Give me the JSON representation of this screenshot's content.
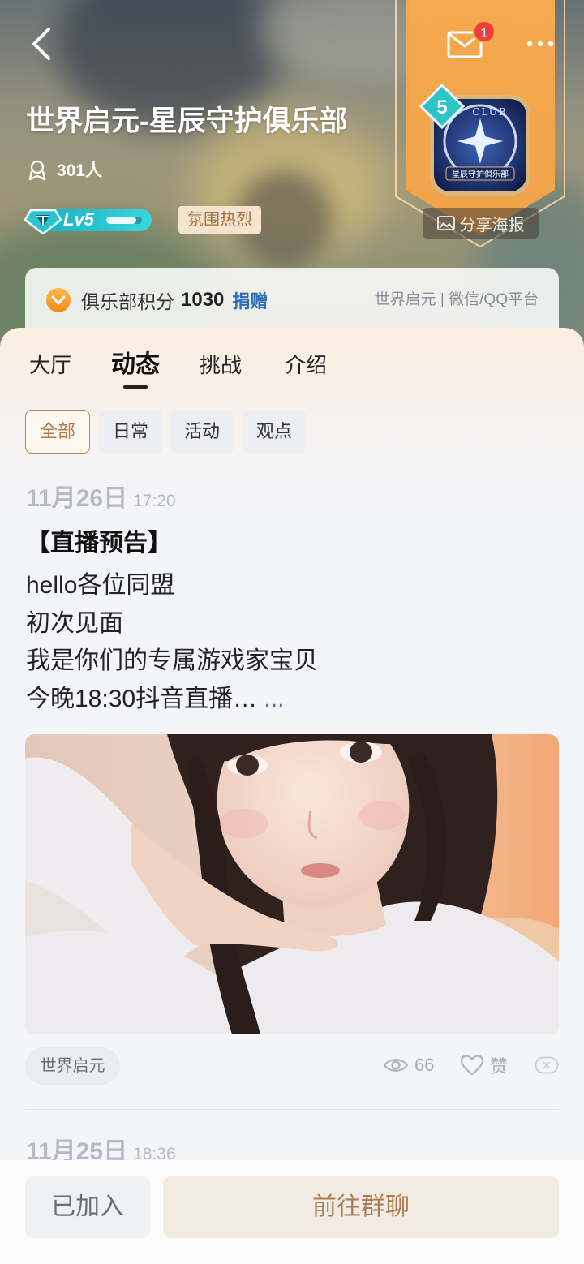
{
  "header": {
    "title": "世界启元-星辰守护俱乐部",
    "members": "301人",
    "level": "Lv5",
    "level_progress": 0.85,
    "atmosphere_tag": "氛围热烈",
    "mail_badge": "1",
    "share_poster": "分享海报",
    "club_level": "5",
    "emblem_top_text": "CLUB",
    "emblem_name": "星辰守护俱乐部"
  },
  "points_card": {
    "label": "俱乐部积分",
    "value": "1030",
    "donate": "捐赠",
    "platform": "世界启元 | 微信/QQ平台"
  },
  "tabs": [
    {
      "label": "大厅",
      "active": false
    },
    {
      "label": "动态",
      "active": true
    },
    {
      "label": "挑战",
      "active": false
    },
    {
      "label": "介绍",
      "active": false
    }
  ],
  "filters": [
    {
      "label": "全部",
      "selected": true
    },
    {
      "label": "日常",
      "selected": false
    },
    {
      "label": "活动",
      "selected": false
    },
    {
      "label": "观点",
      "selected": false
    }
  ],
  "posts": [
    {
      "date": "11月26日",
      "time": "17:20",
      "title": "【直播预告】",
      "lines": [
        "hello各位同盟",
        "初次见面",
        "我是你们的专属游戏家宝贝",
        "今晚18:30抖音直播…"
      ],
      "more": "...",
      "tag": "世界启元",
      "views": "66",
      "like_label": "赞"
    },
    {
      "date": "11月25日",
      "time": "18:36"
    }
  ],
  "bottom_bar": {
    "joined": "已加入",
    "go_chat": "前往群聊"
  },
  "icons": {
    "back": "back-arrow-icon",
    "mail": "mail-icon",
    "more": "more-icon",
    "members": "member-icon",
    "level": "level-diamond-icon",
    "points": "coin-icon",
    "share": "image-icon",
    "views": "eye-icon",
    "like": "heart-icon",
    "dismiss": "dismiss-icon"
  },
  "colors": {
    "accent_brown": "#a87f55",
    "link_blue": "#2f6db5",
    "badge_red": "#ef3e3a",
    "level_cyan": "#22c4d4",
    "banner_orange": "#f2a446"
  }
}
